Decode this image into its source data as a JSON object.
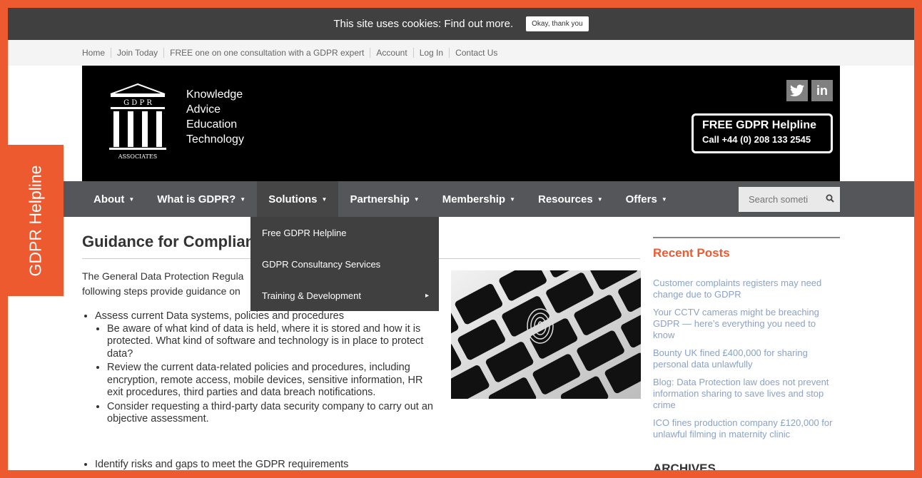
{
  "cookie": {
    "message": "This site uses cookies:",
    "link": "Find out more.",
    "button": "Okay, thank you"
  },
  "top_links": [
    "Home",
    "Join Today",
    "FREE one on one consultation with a GDPR expert",
    "Account",
    "Log In",
    "Contact Us"
  ],
  "header": {
    "logo_top": "G D P R",
    "logo_bottom": "ASSOCIATES",
    "tagline": [
      "Knowledge",
      "Advice",
      "Education",
      "Technology"
    ],
    "social": [
      "twitter-icon",
      "linkedin-icon"
    ],
    "helpline_title": "FREE GDPR Helpline",
    "helpline_phone": "Call +44 (0) 208 133 2545"
  },
  "nav": {
    "items": [
      {
        "label": "About",
        "active": false
      },
      {
        "label": "What is GDPR?",
        "active": false
      },
      {
        "label": "Solutions",
        "active": true
      },
      {
        "label": "Partnership",
        "active": false
      },
      {
        "label": "Membership",
        "active": false
      },
      {
        "label": "Resources",
        "active": false
      },
      {
        "label": "Offers",
        "active": false
      }
    ],
    "search_placeholder": "Search someti"
  },
  "dropdown": [
    {
      "label": "Free GDPR Helpline",
      "has_submenu": false
    },
    {
      "label": "GDPR Consultancy Services",
      "has_submenu": false
    },
    {
      "label": "Training & Development",
      "has_submenu": true
    }
  ],
  "main": {
    "title": "Guidance for Complian",
    "intro": [
      "The General Data Protection Regula",
      "following steps provide guidance on"
    ],
    "bullets": [
      {
        "text": "Assess current Data systems, policies and procedures",
        "sub": [
          "Be aware of what kind of data is held, where it is stored and how it is protected. What kind of software and technology is in place to protect data?",
          "Review the current data-related policies and procedures, including encryption, remote access, mobile devices, sensitive information, HR exit procedures, third parties and data breach notifications.",
          "Consider requesting a third-party data security company to carry out an objective assessment."
        ]
      },
      {
        "text": "Identify risks and gaps to meet the GDPR requirements",
        "sub": []
      }
    ]
  },
  "sidebar": {
    "heading": "Recent Posts",
    "posts": [
      "Customer complaints registers may need change due to GDPR",
      "Your CCTV cameras might be breaching GDPR — here’s everything you need to know",
      "Bounty UK fined £400,000 for sharing personal data unlawfully",
      "Blog: Data Protection law does not prevent information sharing to save lives and stop crime",
      "ICO fines production company £120,000 for unlawful filming in maternity clinic"
    ],
    "archives": "ARCHIVES"
  },
  "side_tab": "GDPR Helpline",
  "colors": {
    "accent": "#ee5a2f",
    "nav_bg": "#555659",
    "link": "#8ba2c5"
  }
}
